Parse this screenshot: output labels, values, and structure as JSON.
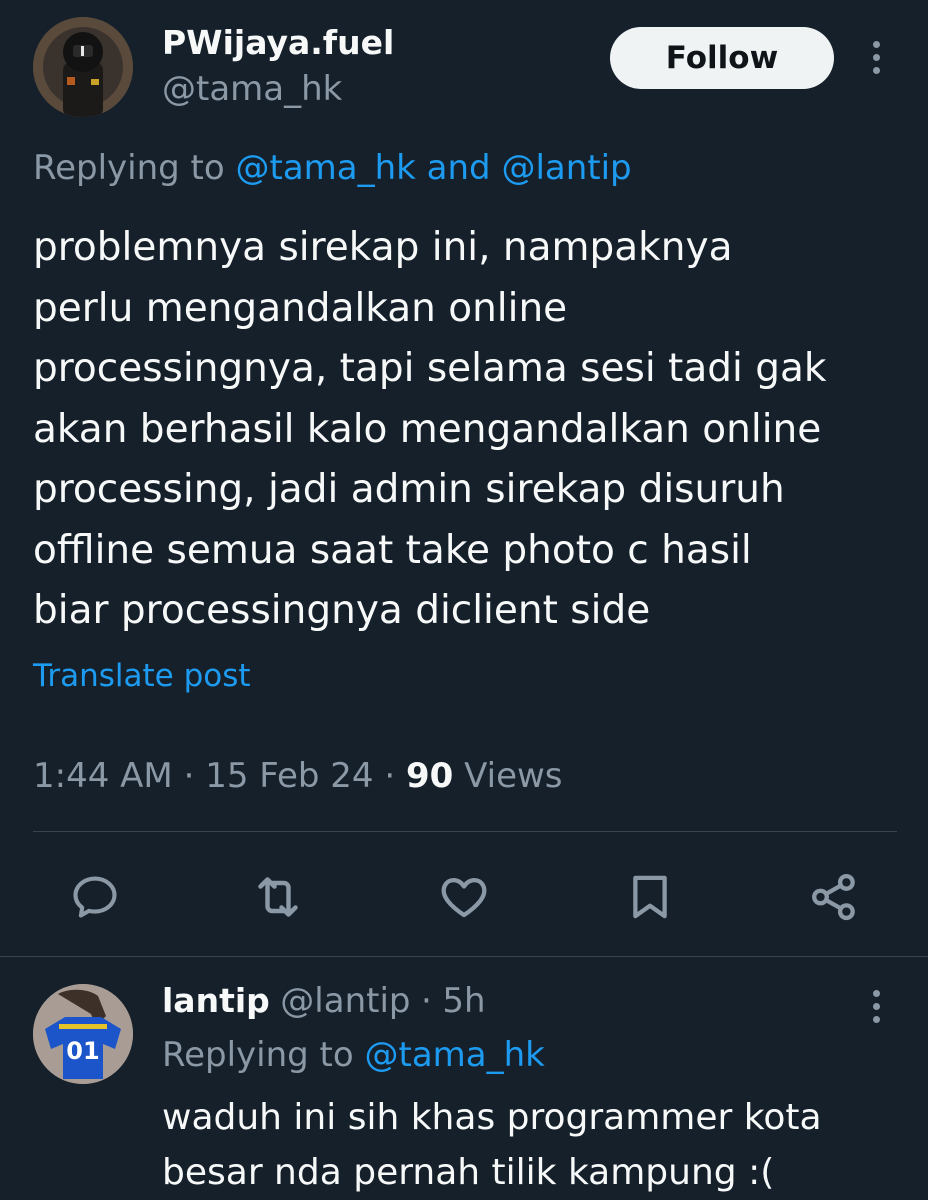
{
  "post": {
    "display_name": "PWijaya.fuel",
    "handle": "@tama_hk",
    "follow_label": "Follow",
    "replying_prefix": "Replying to",
    "replying_mention_1": "@tama_hk",
    "replying_and": "and",
    "replying_mention_2": "@lantip",
    "text_lines": [
      "problemnya sirekap ini, nampaknya",
      "perlu mengandalkan online",
      "processingnya, tapi selama sesi tadi gak",
      "akan berhasil kalo mengandalkan online",
      "processing, jadi admin sirekap disuruh",
      "offline semua saat take photo c hasil",
      "biar processingnya diclient side"
    ],
    "translate_label": "Translate post",
    "time": "1:44 AM",
    "date": "15 Feb 24",
    "views_count": "90",
    "views_label": "Views"
  },
  "actions": {
    "icons": [
      "reply-icon",
      "repost-icon",
      "like-icon",
      "bookmark-icon",
      "share-icon"
    ]
  },
  "reply": {
    "display_name": "lantip",
    "handle": "@lantip",
    "age": "5h",
    "replying_prefix": "Replying to",
    "replying_mention": "@tama_hk",
    "text_lines": [
      "waduh ini sih khas programmer kota",
      "besar nda pernah tilik kampung :("
    ],
    "jersey_number": "01"
  },
  "colors": {
    "background": "#15202b",
    "text": "#f7f9f9",
    "secondary": "#8b98a5",
    "accent": "#1d9bf0",
    "divider": "#38444d"
  }
}
